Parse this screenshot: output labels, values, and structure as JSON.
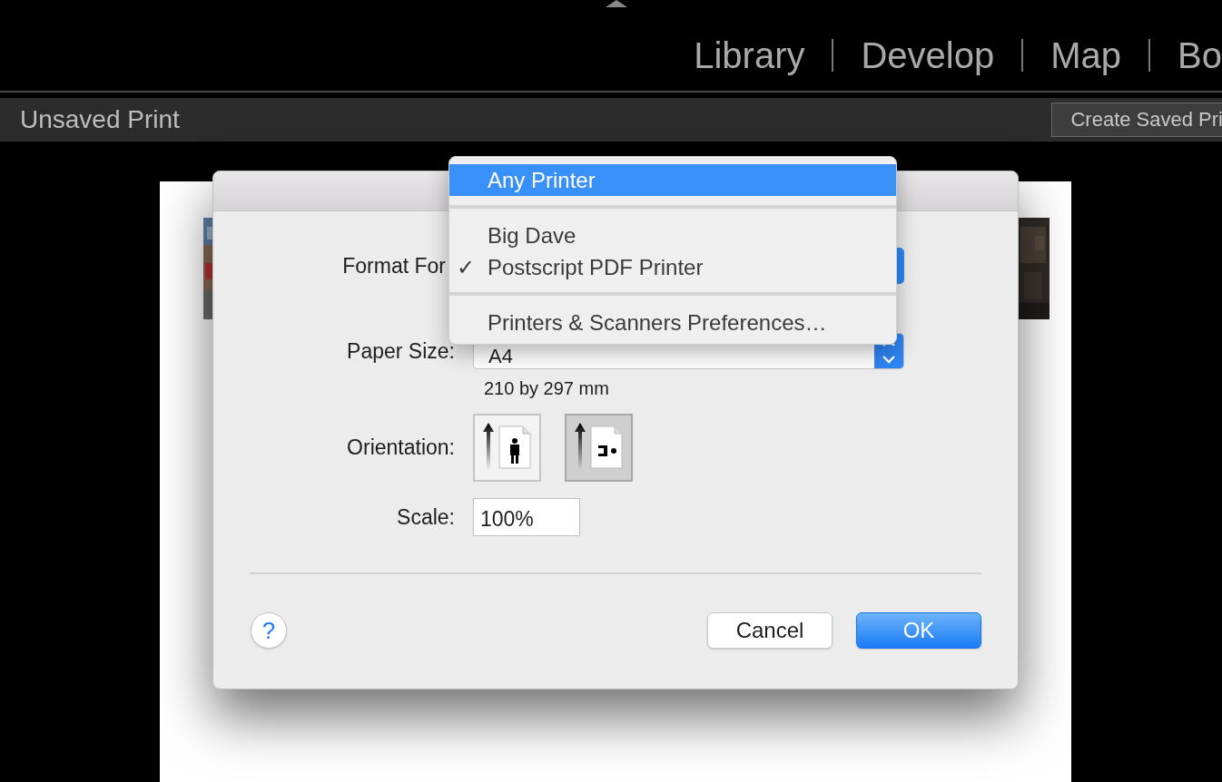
{
  "top_nav": {
    "items": [
      {
        "label": "Library"
      },
      {
        "label": "Develop"
      },
      {
        "label": "Map"
      },
      {
        "label": "Bo"
      }
    ]
  },
  "header": {
    "title": "Unsaved Print",
    "button": "Create Saved Pri"
  },
  "dialog": {
    "format_for": {
      "label": "Format For"
    },
    "paper_size": {
      "label": "Paper Size:",
      "value": "A4",
      "caption": "210 by 297 mm"
    },
    "orientation": {
      "label": "Orientation:",
      "options": [
        {
          "kind": "portrait",
          "selected": false
        },
        {
          "kind": "landscape",
          "selected": true
        }
      ]
    },
    "scale": {
      "label": "Scale:",
      "value": "100%"
    },
    "help": "?",
    "buttons": [
      {
        "label": "Cancel",
        "kind": "secondary"
      },
      {
        "label": "OK",
        "kind": "default"
      }
    ]
  },
  "printer_menu": {
    "check_mark": "✓",
    "items": [
      {
        "kind": "item",
        "label": "Any Printer",
        "selected": true,
        "checked": false
      },
      {
        "kind": "separator"
      },
      {
        "kind": "item",
        "label": "Big Dave",
        "selected": false,
        "checked": false
      },
      {
        "kind": "item",
        "label": "Postscript PDF Printer",
        "selected": false,
        "checked": true
      },
      {
        "kind": "separator"
      },
      {
        "kind": "item",
        "label": "Printers & Scanners Preferences…",
        "selected": false,
        "checked": false
      }
    ]
  }
}
